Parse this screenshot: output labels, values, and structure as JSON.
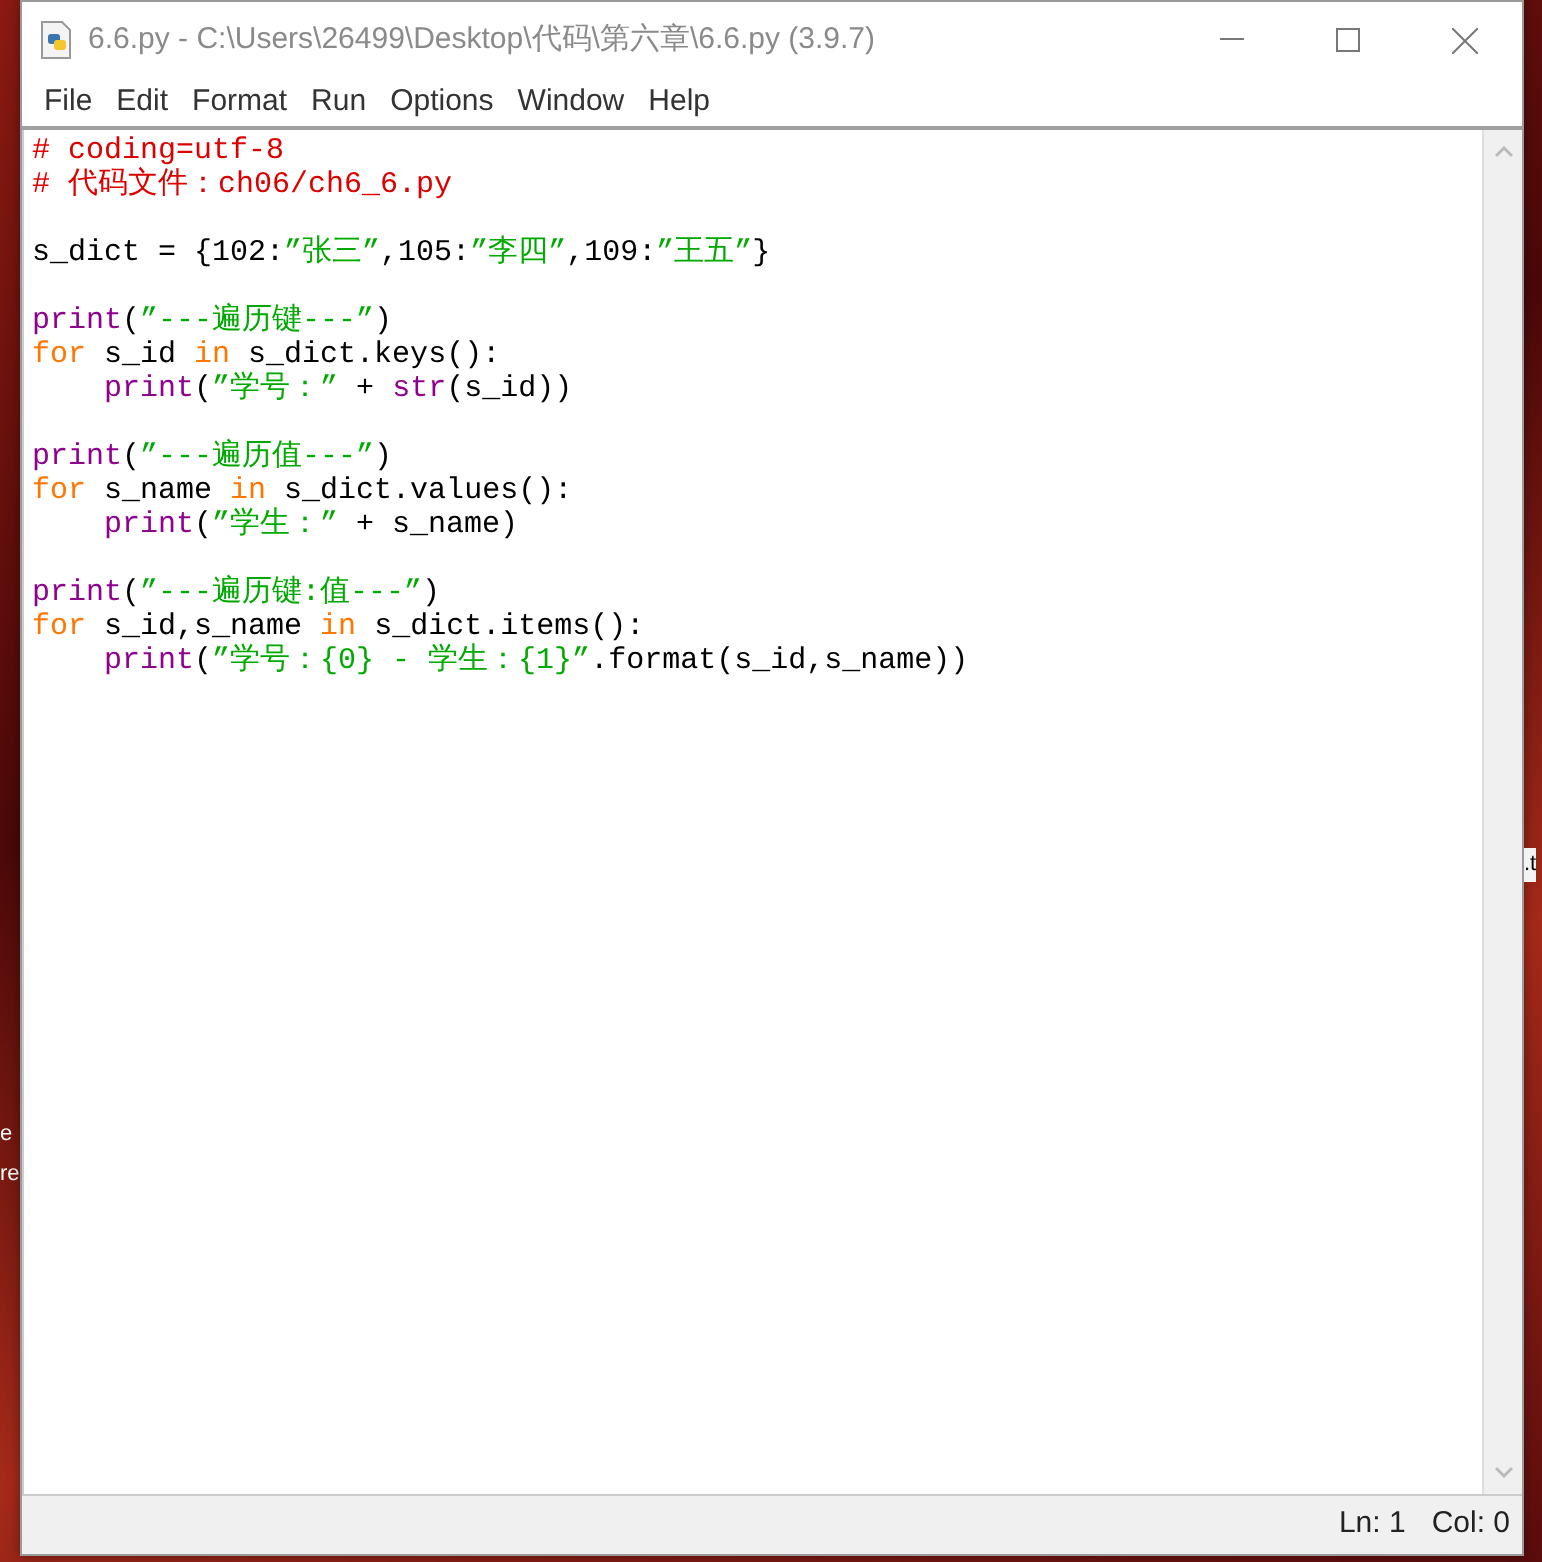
{
  "desktop": {
    "left_labels": [
      {
        "text": "e"
      },
      {
        "text": "re"
      }
    ],
    "right_labels": [
      {
        "text": ".t"
      }
    ]
  },
  "window": {
    "title": "6.6.py - C:\\Users\\26499\\Desktop\\代码\\第六章\\6.6.py (3.9.7)"
  },
  "menu": [
    "File",
    "Edit",
    "Format",
    "Run",
    "Options",
    "Window",
    "Help"
  ],
  "editor": {
    "blocks": [
      {
        "lines": [
          {
            "tokens": [
              {
                "kind": "comment",
                "text": "# coding=utf-8"
              }
            ]
          },
          {
            "tokens": [
              {
                "kind": "comment",
                "text": "# 代码文件：ch06/ch6_6.py"
              }
            ]
          }
        ]
      },
      {
        "lines": [
          {
            "tokens": [
              {
                "kind": "plain",
                "text": "s_dict = {102:"
              },
              {
                "kind": "string",
                "text": "”张三”"
              },
              {
                "kind": "plain",
                "text": ",105:"
              },
              {
                "kind": "string",
                "text": "”李四”"
              },
              {
                "kind": "plain",
                "text": ",109:"
              },
              {
                "kind": "string",
                "text": "”王五”"
              },
              {
                "kind": "plain",
                "text": "}"
              }
            ]
          }
        ]
      },
      {
        "lines": [
          {
            "tokens": [
              {
                "kind": "builtin",
                "text": "print"
              },
              {
                "kind": "plain",
                "text": "("
              },
              {
                "kind": "string",
                "text": "”---遍历键---”"
              },
              {
                "kind": "plain",
                "text": ")"
              }
            ]
          },
          {
            "tokens": [
              {
                "kind": "keyword",
                "text": "for"
              },
              {
                "kind": "plain",
                "text": " s_id "
              },
              {
                "kind": "keyword",
                "text": "in"
              },
              {
                "kind": "plain",
                "text": " s_dict.keys():"
              }
            ],
            "children": [
              {
                "tokens": [
                  {
                    "kind": "builtin",
                    "text": "print"
                  },
                  {
                    "kind": "plain",
                    "text": "("
                  },
                  {
                    "kind": "string",
                    "text": "”学号：”"
                  },
                  {
                    "kind": "plain",
                    "text": " + "
                  },
                  {
                    "kind": "builtin",
                    "text": "str"
                  },
                  {
                    "kind": "plain",
                    "text": "(s_id))"
                  }
                ]
              }
            ]
          }
        ]
      },
      {
        "lines": [
          {
            "tokens": [
              {
                "kind": "builtin",
                "text": "print"
              },
              {
                "kind": "plain",
                "text": "("
              },
              {
                "kind": "string",
                "text": "”---遍历值---”"
              },
              {
                "kind": "plain",
                "text": ")"
              }
            ]
          },
          {
            "tokens": [
              {
                "kind": "keyword",
                "text": "for"
              },
              {
                "kind": "plain",
                "text": " s_name "
              },
              {
                "kind": "keyword",
                "text": "in"
              },
              {
                "kind": "plain",
                "text": " s_dict.values():"
              }
            ],
            "children": [
              {
                "tokens": [
                  {
                    "kind": "builtin",
                    "text": "print"
                  },
                  {
                    "kind": "plain",
                    "text": "("
                  },
                  {
                    "kind": "string",
                    "text": "”学生：”"
                  },
                  {
                    "kind": "plain",
                    "text": " + s_name)"
                  }
                ]
              }
            ]
          }
        ]
      },
      {
        "lines": [
          {
            "tokens": [
              {
                "kind": "builtin",
                "text": "print"
              },
              {
                "kind": "plain",
                "text": "("
              },
              {
                "kind": "string",
                "text": "”---遍历键:值---”"
              },
              {
                "kind": "plain",
                "text": ")"
              }
            ]
          },
          {
            "tokens": [
              {
                "kind": "keyword",
                "text": "for"
              },
              {
                "kind": "plain",
                "text": " s_id,s_name "
              },
              {
                "kind": "keyword",
                "text": "in"
              },
              {
                "kind": "plain",
                "text": " s_dict.items():"
              }
            ],
            "children": [
              {
                "tokens": [
                  {
                    "kind": "builtin",
                    "text": "print"
                  },
                  {
                    "kind": "plain",
                    "text": "("
                  },
                  {
                    "kind": "string",
                    "text": "”学号：{0} - 学生：{1}”"
                  },
                  {
                    "kind": "plain",
                    "text": ".format(s_id,s_name))"
                  }
                ]
              }
            ]
          }
        ]
      }
    ]
  },
  "status_bar": {
    "line": "Ln: 1",
    "column": "Col: 0"
  }
}
